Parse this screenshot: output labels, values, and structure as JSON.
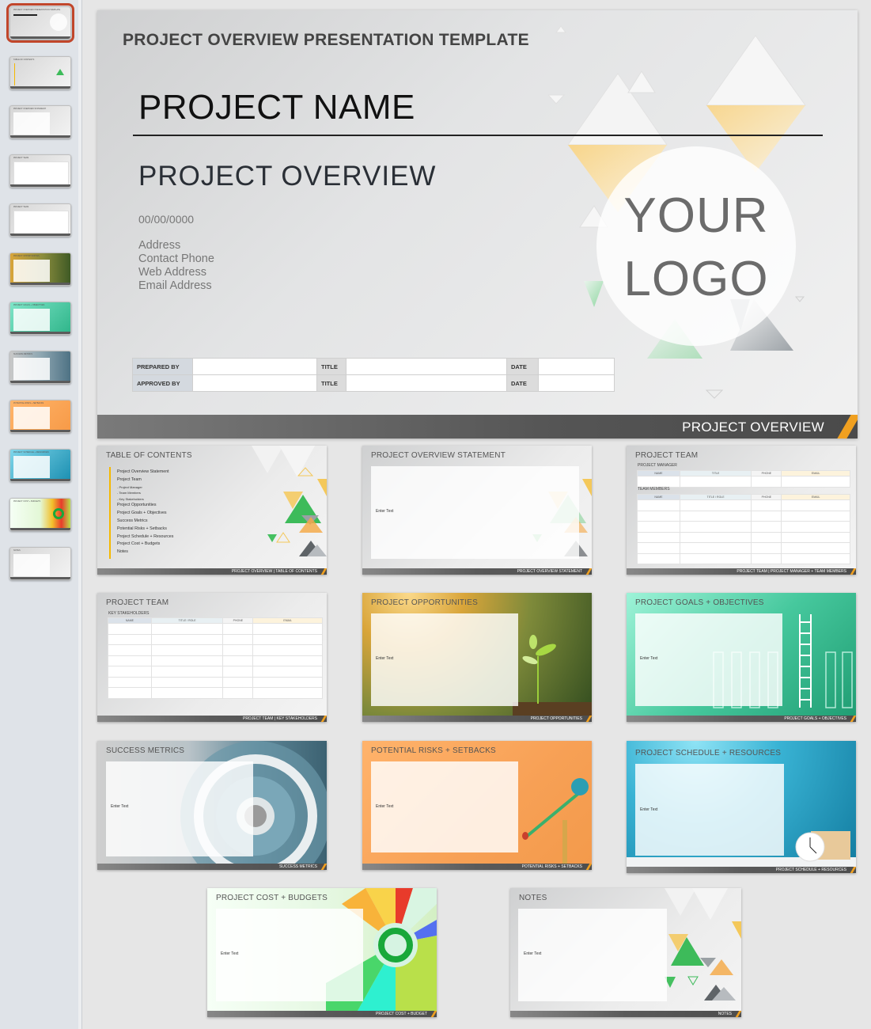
{
  "sidebar": {
    "thumbnails": [
      {
        "title": "PROJECT OVERVIEW PRESENTATION TEMPLATE",
        "selected": true
      },
      {
        "title": "TABLE OF CONTENTS"
      },
      {
        "title": "PROJECT OVERVIEW STATEMENT"
      },
      {
        "title": "PROJECT TEAM"
      },
      {
        "title": "PROJECT TEAM"
      },
      {
        "title": "PROJECT OPPORTUNITIES"
      },
      {
        "title": "PROJECT GOALS + OBJECTIVES"
      },
      {
        "title": "SUCCESS METRICS"
      },
      {
        "title": "POTENTIAL RISKS + SETBACKS"
      },
      {
        "title": "PROJECT SCHEDULE + RESOURCES"
      },
      {
        "title": "PROJECT COST + BUDGETS"
      },
      {
        "title": "NOTES"
      }
    ]
  },
  "main_slide": {
    "template_title": "PROJECT OVERVIEW PRESENTATION TEMPLATE",
    "project_name": "PROJECT NAME",
    "subtitle": "PROJECT OVERVIEW",
    "date": "00/00/0000",
    "contact": [
      "Address",
      "Contact Phone",
      "Web Address",
      "Email Address"
    ],
    "logo": [
      "YOUR",
      "LOGO"
    ],
    "signoff": [
      {
        "role": "PREPARED BY",
        "title_label": "TITLE",
        "date_label": "DATE"
      },
      {
        "role": "APPROVED BY",
        "title_label": "TITLE",
        "date_label": "DATE"
      }
    ],
    "footer": "PROJECT OVERVIEW"
  },
  "slides": {
    "toc": {
      "title": "TABLE OF CONTENTS",
      "items": [
        {
          "text": "Project Overview Statement",
          "sub": false
        },
        {
          "text": "Project Team",
          "sub": false
        },
        {
          "text": "- Project Manager",
          "sub": true
        },
        {
          "text": "- Team Members",
          "sub": true
        },
        {
          "text": "- Key Stakeholders",
          "sub": true
        },
        {
          "text": "Project Opportunities",
          "sub": false
        },
        {
          "text": "Project Goals + Objectives",
          "sub": false
        },
        {
          "text": "Success Metrics",
          "sub": false
        },
        {
          "text": "Potential Risks + Setbacks",
          "sub": false
        },
        {
          "text": "Project Schedule + Resources",
          "sub": false
        },
        {
          "text": "Project Cost + Budgets",
          "sub": false
        },
        {
          "text": "Notes",
          "sub": false
        }
      ],
      "footer": "PROJECT OVERVIEW  |  TABLE OF CONTENTS"
    },
    "statement": {
      "title": "PROJECT OVERVIEW STATEMENT",
      "enter": "Enter Text",
      "footer": "PROJECT OVERVIEW STATEMENT"
    },
    "team1": {
      "title": "PROJECT TEAM",
      "pm_label": "PROJECT MANAGER",
      "pm_headers": [
        "NAME",
        "TITLE",
        "PHONE",
        "EMAIL"
      ],
      "tm_label": "TEAM MEMBERS",
      "tm_headers": [
        "NAME",
        "TITLE / ROLE",
        "PHONE",
        "EMAIL"
      ],
      "footer": "PROJECT TEAM  |  PROJECT MANAGER + TEAM MEMBERS"
    },
    "team2": {
      "title": "PROJECT TEAM",
      "ks_label": "KEY STAKEHOLDERS",
      "ks_headers": [
        "NAME",
        "TITLE / ROLE",
        "PHONE",
        "EMAIL"
      ],
      "footer": "PROJECT TEAM  |  KEY STAKEHOLDERS"
    },
    "opportunities": {
      "title": "PROJECT OPPORTUNITIES",
      "enter": "Enter Text",
      "footer": "PROJECT OPPORTUNITIES"
    },
    "goals": {
      "title": "PROJECT GOALS + OBJECTIVES",
      "enter": "Enter Text",
      "footer": "PROJECT GOALS + OBJECTIVES"
    },
    "metrics": {
      "title": "SUCCESS METRICS",
      "enter": "Enter Text",
      "footer": "SUCCESS METRICS"
    },
    "risks": {
      "title": "POTENTIAL RISKS + SETBACKS",
      "enter": "Enter Text",
      "footer": "POTENTIAL RISKS + SETBACKS"
    },
    "schedule": {
      "title": "PROJECT SCHEDULE + RESOURCES",
      "enter": "Enter Text",
      "footer": "PROJECT SCHEDULE + RESOURCES"
    },
    "cost": {
      "title": "PROJECT COST + BUDGETS",
      "enter": "Enter Text",
      "footer": "PROJECT COST + BUDGET"
    },
    "notes": {
      "title": "NOTES",
      "enter": "Enter Text",
      "footer": "NOTES"
    }
  },
  "colors": {
    "accent_orange": "#f0a020",
    "selection_border": "#c1462b",
    "footer_gray": "#555555",
    "toc_bar": "#f5b800"
  }
}
